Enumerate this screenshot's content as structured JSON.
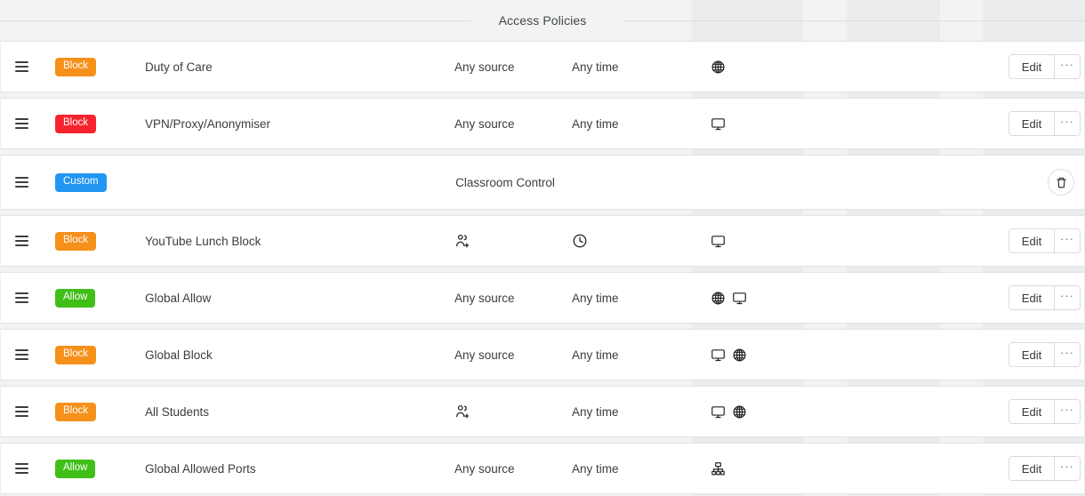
{
  "section": {
    "title": "Access Policies"
  },
  "labels": {
    "edit": "Edit",
    "more": "···",
    "any_source": "Any source",
    "any_time": "Any time"
  },
  "rows": [
    {
      "handle": "drag-handle",
      "badge": {
        "text": "Block",
        "color": "#f5901b",
        "kind": "block-orange"
      },
      "name": "Duty of Care",
      "source": "Any source",
      "time": "Any time",
      "targets": [
        "globe-icon"
      ],
      "actions": [
        "edit",
        "more"
      ]
    },
    {
      "handle": "drag-handle",
      "badge": {
        "text": "Block",
        "color": "#f8232f",
        "kind": "block-red"
      },
      "name": "VPN/Proxy/Anonymiser",
      "source": "Any source",
      "time": "Any time",
      "targets": [
        "monitor-icon"
      ],
      "actions": [
        "edit",
        "more"
      ]
    },
    {
      "handle": "drag-handle",
      "badge": {
        "text": "Custom",
        "color": "#2196f3",
        "kind": "custom-blue"
      },
      "name": "Classroom Control",
      "source": "",
      "time": "",
      "targets": [],
      "actions": [
        "trash"
      ],
      "layout": "centered"
    },
    {
      "handle": "drag-handle",
      "badge": {
        "text": "Block",
        "color": "#f5901b",
        "kind": "block-orange"
      },
      "name": "YouTube Lunch Block",
      "source": "user-group-icon",
      "time": "clock-icon",
      "targets": [
        "monitor-icon"
      ],
      "actions": [
        "edit",
        "more"
      ]
    },
    {
      "handle": "drag-handle",
      "badge": {
        "text": "Allow",
        "color": "#3fbf17",
        "kind": "allow-green"
      },
      "name": "Global Allow",
      "source": "Any source",
      "time": "Any time",
      "targets": [
        "globe-icon",
        "monitor-icon"
      ],
      "actions": [
        "edit",
        "more"
      ]
    },
    {
      "handle": "drag-handle",
      "badge": {
        "text": "Block",
        "color": "#f5901b",
        "kind": "block-orange"
      },
      "name": "Global Block",
      "source": "Any source",
      "time": "Any time",
      "targets": [
        "monitor-icon",
        "globe-icon"
      ],
      "actions": [
        "edit",
        "more"
      ]
    },
    {
      "handle": "drag-handle",
      "badge": {
        "text": "Block",
        "color": "#f5901b",
        "kind": "block-orange"
      },
      "name": "All Students",
      "source": "user-group-icon",
      "time": "Any time",
      "targets": [
        "monitor-icon",
        "globe-icon"
      ],
      "actions": [
        "edit",
        "more"
      ]
    },
    {
      "handle": "drag-handle",
      "badge": {
        "text": "Allow",
        "color": "#3fbf17",
        "kind": "allow-green"
      },
      "name": "Global Allowed Ports",
      "source": "Any source",
      "time": "Any time",
      "targets": [
        "network-icon"
      ],
      "actions": [
        "edit",
        "more"
      ]
    }
  ]
}
